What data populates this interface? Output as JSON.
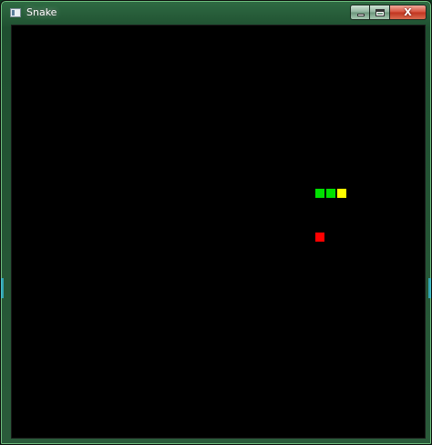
{
  "window": {
    "title": "Snake",
    "icon": "app-window-icon",
    "caption_buttons": {
      "minimize_icon": "minimize-icon",
      "maximize_icon": "maximize-icon",
      "close_label": "X"
    }
  },
  "game": {
    "background_color": "#000000",
    "snake": {
      "segments": [
        {
          "col": 0,
          "row": 0,
          "role": "body",
          "color": "#00e000"
        },
        {
          "col": 1,
          "row": 0,
          "role": "body",
          "color": "#00e000"
        },
        {
          "col": 2,
          "row": 0,
          "role": "head",
          "color": "#ffff00"
        }
      ],
      "direction": "right"
    },
    "food": {
      "col": 0,
      "row": 4,
      "color": "#ff0000"
    }
  }
}
